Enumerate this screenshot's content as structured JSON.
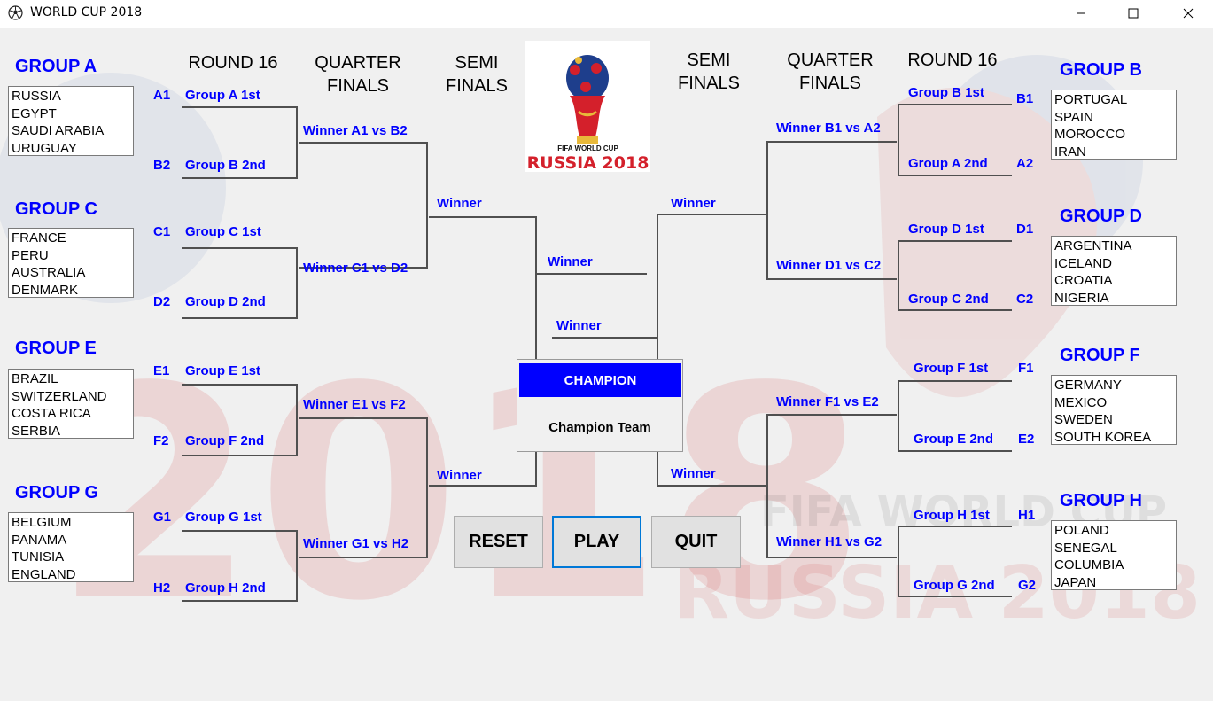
{
  "window": {
    "title": "WORLD CUP 2018"
  },
  "headers": {
    "left_round16": "ROUND 16",
    "left_quarter": [
      "QUARTER",
      "FINALS"
    ],
    "left_semi": [
      "SEMI",
      "FINALS"
    ],
    "right_semi": [
      "SEMI",
      "FINALS"
    ],
    "right_quarter": [
      "QUARTER",
      "FINALS"
    ],
    "right_round16": "ROUND 16"
  },
  "groups": {
    "A": {
      "title": "GROUP A",
      "teams": [
        "RUSSIA",
        "EGYPT",
        "SAUDI ARABIA",
        "URUGUAY"
      ]
    },
    "B": {
      "title": "GROUP B",
      "teams": [
        "PORTUGAL",
        "SPAIN",
        "MOROCCO",
        "IRAN"
      ]
    },
    "C": {
      "title": "GROUP C",
      "teams": [
        "FRANCE",
        "PERU",
        "AUSTRALIA",
        "DENMARK"
      ]
    },
    "D": {
      "title": "GROUP D",
      "teams": [
        "ARGENTINA",
        "ICELAND",
        "CROATIA",
        "NIGERIA"
      ]
    },
    "E": {
      "title": "GROUP E",
      "teams": [
        "BRAZIL",
        "SWITZERLAND",
        "COSTA RICA",
        "SERBIA"
      ]
    },
    "F": {
      "title": "GROUP F",
      "teams": [
        "GERMANY",
        "MEXICO",
        "SWEDEN",
        "SOUTH KOREA"
      ]
    },
    "G": {
      "title": "GROUP G",
      "teams": [
        "BELGIUM",
        "PANAMA",
        "TUNISIA",
        "ENGLAND"
      ]
    },
    "H": {
      "title": "GROUP H",
      "teams": [
        "POLAND",
        "SENEGAL",
        "COLUMBIA",
        "JAPAN"
      ]
    }
  },
  "round16": {
    "left": [
      {
        "code": "A1",
        "label": "Group A 1st"
      },
      {
        "code": "B2",
        "label": "Group B 2nd"
      },
      {
        "code": "C1",
        "label": "Group C 1st"
      },
      {
        "code": "D2",
        "label": "Group D 2nd"
      },
      {
        "code": "E1",
        "label": "Group E 1st"
      },
      {
        "code": "F2",
        "label": "Group F 2nd"
      },
      {
        "code": "G1",
        "label": "Group G 1st"
      },
      {
        "code": "H2",
        "label": "Group H 2nd"
      }
    ],
    "right": [
      {
        "code": "B1",
        "label": "Group B 1st"
      },
      {
        "code": "A2",
        "label": "Group A 2nd"
      },
      {
        "code": "D1",
        "label": "Group D 1st"
      },
      {
        "code": "C2",
        "label": "Group C 2nd"
      },
      {
        "code": "F1",
        "label": "Group F 1st"
      },
      {
        "code": "E2",
        "label": "Group E 2nd"
      },
      {
        "code": "H1",
        "label": "Group H 1st"
      },
      {
        "code": "G2",
        "label": "Group G 2nd"
      }
    ]
  },
  "quarter": {
    "left": [
      "Winner A1 vs B2",
      "Winner C1 vs D2",
      "Winner E1 vs F2",
      "Winner G1 vs H2"
    ],
    "right": [
      "Winner B1 vs A2",
      "Winner D1 vs C2",
      "Winner F1 vs E2",
      "Winner H1 vs G2"
    ]
  },
  "semi": {
    "left_top": "Winner",
    "left_bottom": "Winner",
    "right_top": "Winner",
    "right_bottom": "Winner"
  },
  "final": {
    "left": "Winner",
    "right": "Winner"
  },
  "logo": {
    "line1": "FIFA WORLD CUP",
    "line2": "RUSSIA 2018"
  },
  "watermark": {
    "line1": "FIFA WORLD CUP",
    "line2": "RUSSIA 2018",
    "big": "2018"
  },
  "champion": {
    "header": "CHAMPION",
    "team": "Champion Team"
  },
  "buttons": {
    "reset": "RESET",
    "play": "PLAY",
    "quit": "QUIT"
  },
  "colors": {
    "accent": "#0000ff",
    "line": "#505050",
    "focus": "#0078d7"
  }
}
